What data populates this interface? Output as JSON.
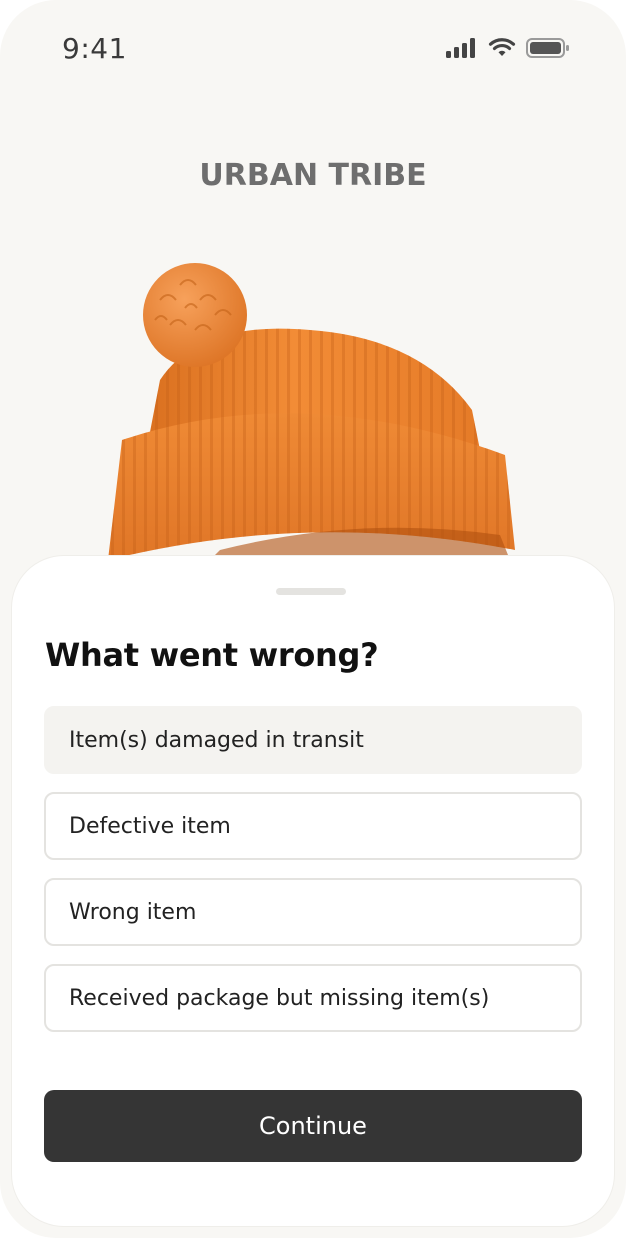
{
  "status_bar": {
    "time": "9:41",
    "icons": [
      "signal-icon",
      "wifi-icon",
      "battery-icon"
    ]
  },
  "brand": {
    "name": "URBAN TRIBE"
  },
  "product": {
    "image": "orange-beanie-hat",
    "color": "#e8832e"
  },
  "sheet": {
    "title": "What went wrong?",
    "options": [
      {
        "label": "Item(s) damaged in transit",
        "selected": true
      },
      {
        "label": "Defective item",
        "selected": false
      },
      {
        "label": "Wrong item",
        "selected": false
      },
      {
        "label": "Received package but missing item(s)",
        "selected": false
      }
    ],
    "continue_label": "Continue"
  },
  "colors": {
    "background": "#f8f7f4",
    "button": "#353535",
    "selected_option": "#f4f3f0",
    "option_border": "#e4e3e0",
    "brand_text": "#6e6e6e"
  }
}
